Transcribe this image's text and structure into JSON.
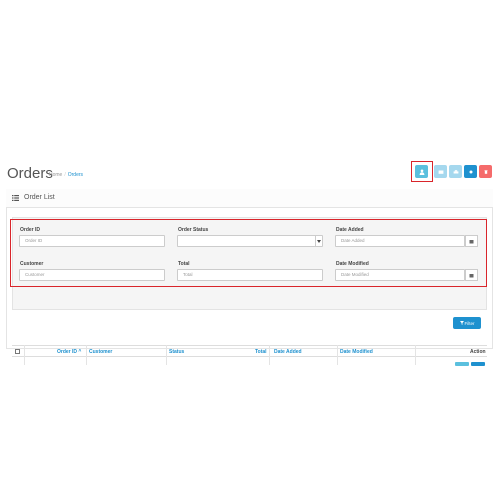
{
  "header": {
    "title": "Orders",
    "breadcrumb": [
      {
        "label": "Home"
      },
      {
        "label": "Orders"
      }
    ]
  },
  "toolbar": {
    "buttons": [
      {
        "icon": "user-icon",
        "color": "#5bc0de"
      },
      {
        "icon": "envelope-icon",
        "color": "#a5d8ee"
      },
      {
        "icon": "print-icon",
        "color": "#a5d8ee"
      },
      {
        "icon": "plus-icon",
        "color": "#1e91cf"
      },
      {
        "icon": "trash-icon",
        "color": "#f56b6b"
      }
    ]
  },
  "panel": {
    "heading": "Order List",
    "heading_icon": "list-icon"
  },
  "filters": {
    "order_id": {
      "label": "Order ID",
      "placeholder": "Order ID",
      "value": ""
    },
    "order_status": {
      "label": "Order Status",
      "value": ""
    },
    "date_added": {
      "label": "Date Added",
      "placeholder": "Date Added",
      "value": "",
      "icon": "calendar-icon"
    },
    "customer": {
      "label": "Customer",
      "placeholder": "Customer",
      "value": ""
    },
    "total": {
      "label": "Total",
      "placeholder": "Total",
      "value": ""
    },
    "date_modified": {
      "label": "Date Modified",
      "placeholder": "Date Modified",
      "value": "",
      "icon": "calendar-icon"
    },
    "filter_button": {
      "label": "Filter",
      "icon": "filter-icon"
    }
  },
  "table": {
    "columns": [
      {
        "label": "Order ID",
        "sort": "asc"
      },
      {
        "label": "Customer"
      },
      {
        "label": "Status"
      },
      {
        "label": "Total"
      },
      {
        "label": "Date Added"
      },
      {
        "label": "Date Modified"
      },
      {
        "label": "Action"
      }
    ]
  },
  "colors": {
    "accent": "#1e91cf",
    "highlight": "#d9252b"
  }
}
